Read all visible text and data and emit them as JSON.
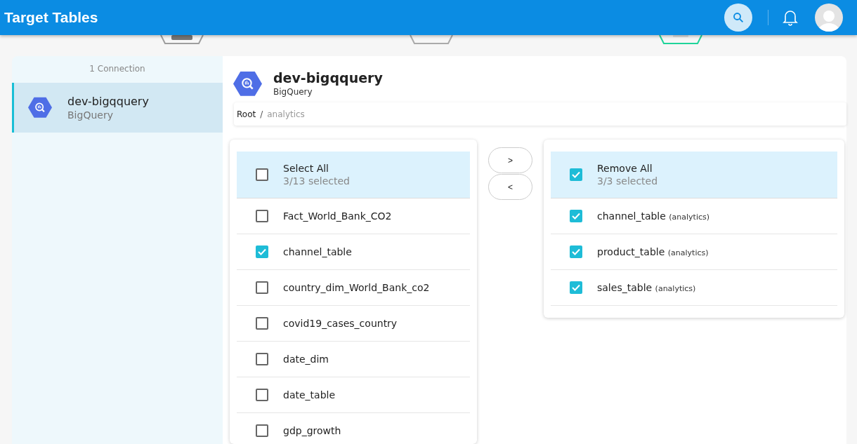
{
  "header": {
    "title": "Target Tables"
  },
  "steps": [
    {
      "kind": "done"
    },
    {
      "kind": "todo"
    },
    {
      "kind": "active"
    }
  ],
  "sidebar": {
    "count": "1 Connection",
    "items": [
      {
        "name": "dev-bigqquery",
        "type": "BigQuery",
        "selected": true
      }
    ]
  },
  "detail": {
    "name": "dev-bigqquery",
    "type": "BigQuery",
    "breadcrumb": [
      "Root",
      "analytics"
    ],
    "breadcrumb_separator": "/"
  },
  "source": {
    "header": {
      "label": "Select All",
      "count": "3/13 selected",
      "checked": false
    },
    "items": [
      {
        "name": "Fact_World_Bank_CO2",
        "checked": false
      },
      {
        "name": "channel_table",
        "checked": true
      },
      {
        "name": "country_dim_World_Bank_co2",
        "checked": false
      },
      {
        "name": "covid19_cases_country",
        "checked": false
      },
      {
        "name": "date_dim",
        "checked": false
      },
      {
        "name": "date_table",
        "checked": false
      },
      {
        "name": "gdp_growth",
        "checked": false
      }
    ]
  },
  "transfer_buttons": [
    ">",
    "<"
  ],
  "target": {
    "header": {
      "label": "Remove All",
      "count": "3/3 selected",
      "checked": true
    },
    "items": [
      {
        "name": "channel_table",
        "schema": "(analytics)",
        "checked": true
      },
      {
        "name": "product_table",
        "schema": "(analytics)",
        "checked": true
      },
      {
        "name": "sales_table",
        "schema": "(analytics)",
        "checked": true
      }
    ]
  }
}
